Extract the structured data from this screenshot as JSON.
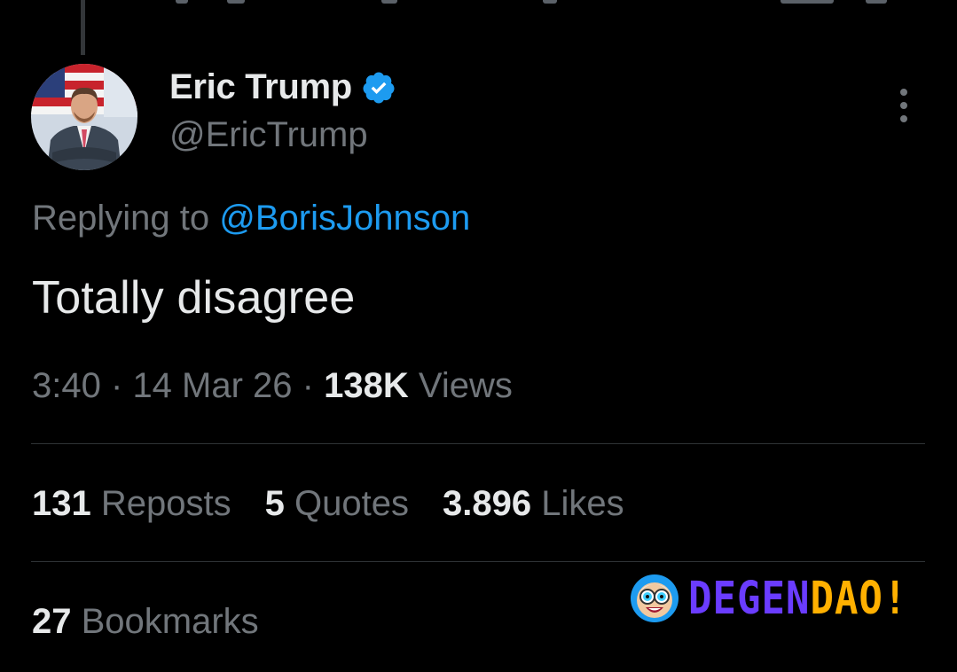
{
  "author": {
    "display_name": "Eric Trump",
    "handle": "@EricTrump",
    "verified_icon": "verified-badge-icon",
    "avatar_description": "man-in-suit-with-flag"
  },
  "more_icon": "more-vertical-icon",
  "reply_context": {
    "prefix": "Replying to",
    "mention": "@BorisJohnson"
  },
  "tweet": {
    "text": "Totally disagree",
    "time": "3:40",
    "date": "14 Mar 26",
    "views_count": "138K",
    "views_label": "Views",
    "separator": "·"
  },
  "stats": {
    "reposts_count": "131",
    "reposts_label": "Reposts",
    "quotes_count": "5",
    "quotes_label": "Quotes",
    "likes_count": "3.896",
    "likes_label": "Likes",
    "bookmarks_count": "27",
    "bookmarks_label": "Bookmarks"
  },
  "watermark": {
    "part1": "DEGEN",
    "part2": "DAO!",
    "part1_color": "#6a3cff",
    "part2_color": "#ffb000",
    "logo_icon": "cartoon-face-goggles-icon"
  },
  "colors": {
    "background": "#000000",
    "text_primary": "#e7e9ea",
    "text_secondary": "#71767b",
    "accent": "#1d9bf0",
    "divider": "#2f3336"
  }
}
